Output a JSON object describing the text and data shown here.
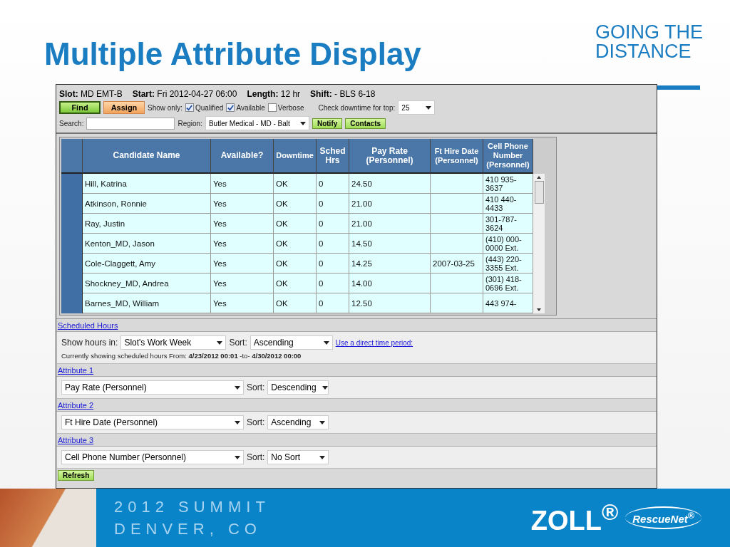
{
  "slide": {
    "title": "Multiple Attribute Display",
    "tagline": [
      "GOING THE",
      "DISTANCE"
    ],
    "footer": {
      "event": "2012 SUMMIT",
      "location": "DENVER, CO",
      "logo": "ZOLL$^{®}$",
      "product": "RescueNet$^{®}$"
    }
  },
  "app": {
    "slot_info": [
      {
        "label": "Slot:",
        "value": "MD EMT-B"
      },
      {
        "label": "Start:",
        "value": "Fri 2012-04-27 06:00"
      },
      {
        "label": "Length:",
        "value": "12 hr"
      },
      {
        "label": "Shift:",
        "value": "- BLS 6-18"
      }
    ],
    "buttons": [
      {
        "label": "Find",
        "kind": "find"
      },
      {
        "label": "Assign",
        "kind": "assign"
      }
    ],
    "show_only": {
      "label": "Show only:",
      "options": [
        {
          "label": "Qualified",
          "checked": true
        },
        {
          "label": "Available",
          "checked": true
        },
        {
          "label": "Verbose",
          "checked": false
        }
      ]
    },
    "downtime": {
      "label": "Check downtime for top:",
      "value": "25"
    },
    "search": {
      "label": "Search:"
    },
    "region": {
      "label": "Region:",
      "value": "Butler Medical - MD - Balt"
    },
    "actions": [
      "Notify",
      "Contacts"
    ],
    "table": {
      "columns": [
        "Candidate Name",
        "Available?",
        "Downtime",
        "Sched Hrs",
        "Pay Rate (Personnel)",
        "Ft Hire Date (Personnel)",
        "Cell Phone Number (Personnel)"
      ],
      "rows": [
        [
          "Hill, Katrina",
          "Yes",
          "OK",
          "0",
          "24.50",
          "",
          "410 935-3637"
        ],
        [
          "Atkinson, Ronnie",
          "Yes",
          "OK",
          "0",
          "21.00",
          "",
          "410 440-4433"
        ],
        [
          "Ray, Justin",
          "Yes",
          "OK",
          "0",
          "21.00",
          "",
          "301-787-3624"
        ],
        [
          "Kenton_MD, Jason",
          "Yes",
          "OK",
          "0",
          "14.50",
          "",
          "(410) 000-0000 Ext."
        ],
        [
          "Cole-Claggett, Amy",
          "Yes",
          "OK",
          "0",
          "14.25",
          "2007-03-25",
          "(443) 220-3355 Ext."
        ],
        [
          "Shockney_MD, Andrea",
          "Yes",
          "OK",
          "0",
          "14.00",
          "",
          "(301) 418-0696 Ext."
        ],
        [
          "Barnes_MD, William",
          "Yes",
          "OK",
          "0",
          "12.50",
          "",
          "443 974-"
        ]
      ]
    },
    "scheduled_hours": {
      "link": "Scheduled Hours",
      "show_label": "Show hours in:",
      "value": "Slot's Work Week",
      "sort_label": "Sort:",
      "sort": "Ascending",
      "direct_link": "Use a direct time period:",
      "note": "Currently showing scheduled hours From: **4/23/2012 00:01** -to- **4/30/2012 00:00**"
    },
    "attributes": [
      {
        "link": "Attribute 1",
        "value": "Pay Rate (Personnel)",
        "sort_label": "Sort:",
        "sort": "Descending"
      },
      {
        "link": "Attribute 2",
        "value": "Ft Hire Date (Personnel)",
        "sort_label": "Sort:",
        "sort": "Ascending"
      },
      {
        "link": "Attribute 3",
        "value": "Cell Phone Number (Personnel)",
        "sort_label": "Sort:",
        "sort": "No Sort"
      }
    ],
    "refresh": "Refresh"
  }
}
